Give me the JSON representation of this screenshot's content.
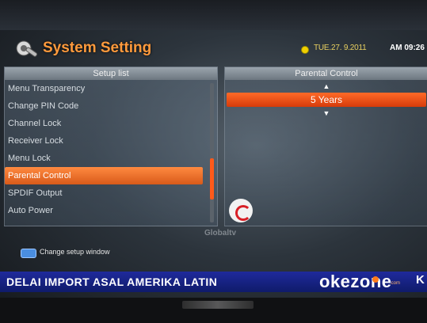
{
  "header": {
    "title": "System Setting",
    "date": "TUE.27. 9.2011",
    "time": "AM 09:26"
  },
  "left_panel": {
    "title": "Setup list",
    "items": [
      {
        "label": "Menu Transparency"
      },
      {
        "label": "Change PIN Code"
      },
      {
        "label": "Channel Lock"
      },
      {
        "label": "Receiver Lock"
      },
      {
        "label": "Menu Lock"
      },
      {
        "label": "Parental Control"
      },
      {
        "label": "SPDIF Output"
      },
      {
        "label": "Auto Power"
      }
    ],
    "selected_index": 5
  },
  "right_panel": {
    "title": "Parental Control",
    "up_arrow": "▲",
    "value": "5 Years",
    "down_arrow": "▼"
  },
  "hint": {
    "text": "Change setup window"
  },
  "watermark": "Globaltv",
  "ticker": {
    "text": "DELAI IMPORT ASAL AMERIKA LATIN",
    "brand": "okezone",
    "brand_suffix": ".com",
    "next": "K"
  },
  "colors": {
    "accent": "#ff9a3c",
    "selected": "#d85a1a",
    "ticker_bg": "#1f2a9c"
  }
}
